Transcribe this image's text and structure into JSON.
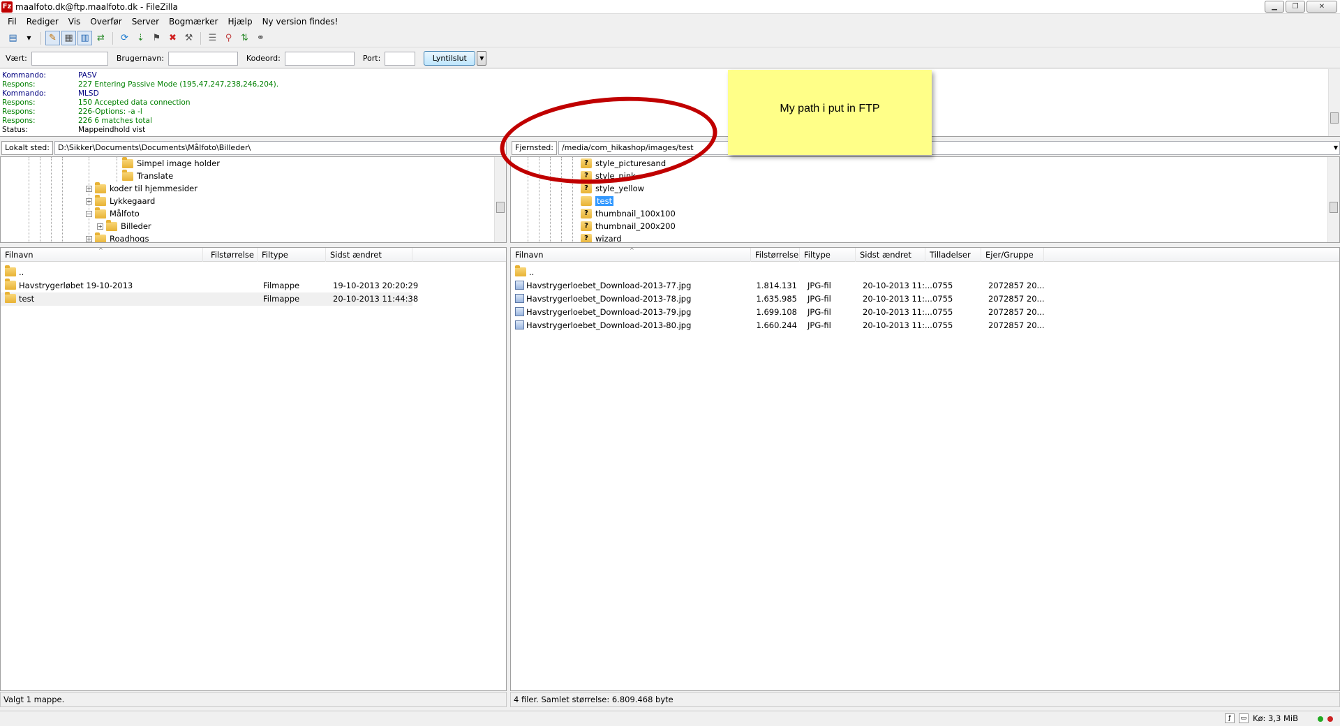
{
  "window": {
    "title": "maalfoto.dk@ftp.maalfoto.dk - FileZilla",
    "app_icon_label": "Fz"
  },
  "menu": [
    "Fil",
    "Rediger",
    "Vis",
    "Overfør",
    "Server",
    "Bogmærker",
    "Hjælp",
    "Ny version findes!"
  ],
  "quickconnect": {
    "host_label": "Vært:",
    "user_label": "Brugernavn:",
    "pass_label": "Kodeord:",
    "port_label": "Port:",
    "host_value": "",
    "user_value": "",
    "pass_value": "",
    "port_value": "",
    "connect_label": "Lyntilslut"
  },
  "log": [
    {
      "type": "Kommando:",
      "msg": "PASV",
      "kind": "cmd"
    },
    {
      "type": "Respons:",
      "msg": "227 Entering Passive Mode (195,47,247,238,246,204).",
      "kind": "resp"
    },
    {
      "type": "Kommando:",
      "msg": "MLSD",
      "kind": "cmd"
    },
    {
      "type": "Respons:",
      "msg": "150 Accepted data connection",
      "kind": "resp"
    },
    {
      "type": "Respons:",
      "msg": "226-Options: -a -l",
      "kind": "resp"
    },
    {
      "type": "Respons:",
      "msg": "226 6 matches total",
      "kind": "resp"
    },
    {
      "type": "Status:",
      "msg": "Mappeindhold vist",
      "kind": "stat"
    }
  ],
  "annotation": {
    "note_text": "My path i put in FTP",
    "note_color": "#ffff88",
    "circle_color": "#c00000"
  },
  "local": {
    "site_label": "Lokalt sted:",
    "path": "D:\\Sikker\\Documents\\Documents\\Målfoto\\Billeder\\",
    "tree": [
      {
        "label": "Simpel image holder",
        "level": 3,
        "expander": ""
      },
      {
        "label": "Translate",
        "level": 3,
        "expander": ""
      },
      {
        "label": "koder til hjemmesider",
        "level": 1,
        "expander": "+"
      },
      {
        "label": "Lykkegaard",
        "level": 1,
        "expander": "+"
      },
      {
        "label": "Målfoto",
        "level": 1,
        "expander": "−"
      },
      {
        "label": "Billeder",
        "level": 2,
        "expander": "+"
      },
      {
        "label": "Roadhogs",
        "level": 1,
        "expander": "+"
      }
    ],
    "columns": [
      "Filnavn",
      "Filstørrelse",
      "Filtype",
      "Sidst ændret"
    ],
    "files": [
      {
        "name": "..",
        "size": "",
        "type": "",
        "modified": ""
      },
      {
        "name": "Havstrygerløbet 19-10-2013",
        "size": "",
        "type": "Filmappe",
        "modified": "19-10-2013 20:20:29"
      },
      {
        "name": "test",
        "size": "",
        "type": "Filmappe",
        "modified": "20-10-2013 11:44:38"
      }
    ],
    "status": "Valgt 1 mappe."
  },
  "remote": {
    "site_label": "Fjernsted:",
    "path": "/media/com_hikashop/images/test",
    "tree": [
      {
        "label": "style_picturesand"
      },
      {
        "label": "style_pink"
      },
      {
        "label": "style_yellow"
      },
      {
        "label": "test"
      },
      {
        "label": "thumbnail_100x100"
      },
      {
        "label": "thumbnail_200x200"
      },
      {
        "label": "wizard"
      }
    ],
    "columns": [
      "Filnavn",
      "Filstørrelse",
      "Filtype",
      "Sidst ændret",
      "Tilladelser",
      "Ejer/Gruppe"
    ],
    "files": [
      {
        "name": "..",
        "size": "",
        "type": "",
        "modified": "",
        "perms": "",
        "owner": ""
      },
      {
        "name": "Havstrygerloebet_Download-2013-77.jpg",
        "size": "1.814.131",
        "type": "JPG-fil",
        "modified": "20-10-2013 11:...",
        "perms": "0755",
        "owner": "2072857 20..."
      },
      {
        "name": "Havstrygerloebet_Download-2013-78.jpg",
        "size": "1.635.985",
        "type": "JPG-fil",
        "modified": "20-10-2013 11:...",
        "perms": "0755",
        "owner": "2072857 20..."
      },
      {
        "name": "Havstrygerloebet_Download-2013-79.jpg",
        "size": "1.699.108",
        "type": "JPG-fil",
        "modified": "20-10-2013 11:...",
        "perms": "0755",
        "owner": "2072857 20..."
      },
      {
        "name": "Havstrygerloebet_Download-2013-80.jpg",
        "size": "1.660.244",
        "type": "JPG-fil",
        "modified": "20-10-2013 11:...",
        "perms": "0755",
        "owner": "2072857 20..."
      }
    ],
    "status": "4 filer. Samlet størrelse: 6.809.468 byte"
  },
  "bottom": {
    "queue": "Kø: 3,3 MiB",
    "led_colors": [
      "#22aa22",
      "#cc2222"
    ]
  }
}
